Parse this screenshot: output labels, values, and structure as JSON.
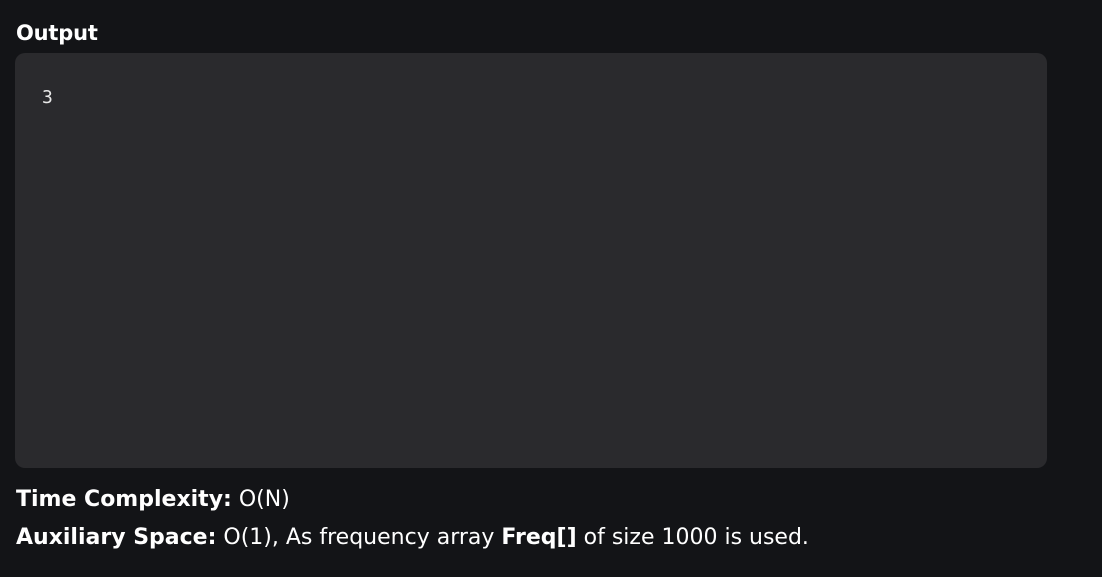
{
  "output_section": {
    "title": "Output",
    "result": "3"
  },
  "complexity": {
    "time_label": "Time Complexity:",
    "time_value": " O(N)",
    "space_label": "Auxiliary Space:",
    "space_value_prefix": " O(1), As frequency array ",
    "space_value_bold": "Freq[]",
    "space_value_suffix": " of size 1000 is used."
  },
  "colors": {
    "page_background": "#131417",
    "output_background": "#2a2a2d",
    "text": "#ffffff"
  }
}
